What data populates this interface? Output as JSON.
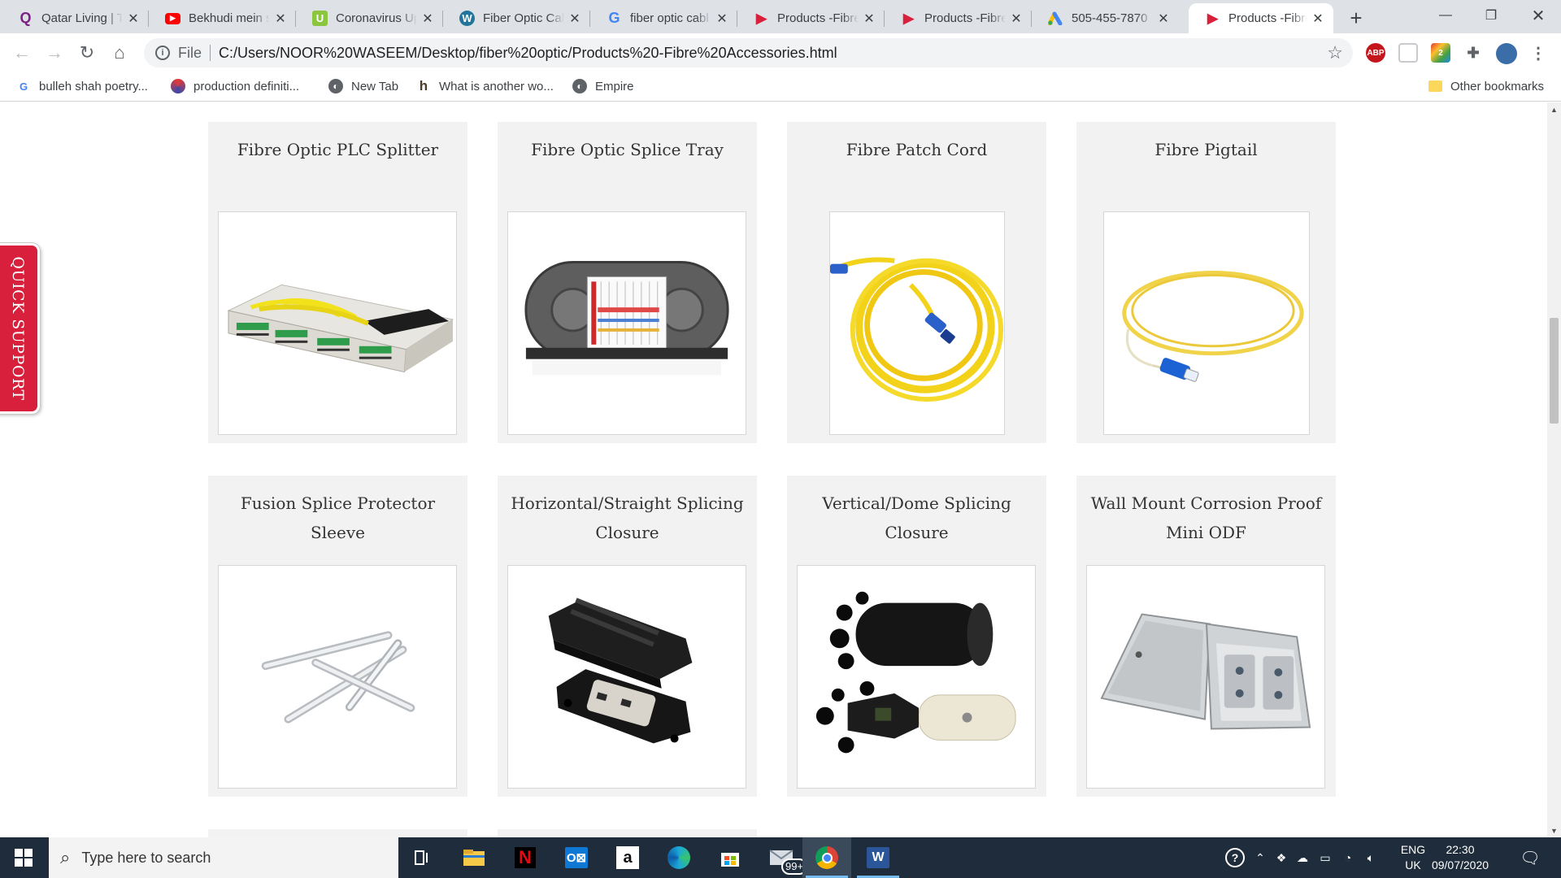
{
  "browser": {
    "tabs": [
      {
        "title": "Qatar Living | T",
        "icon": "qatar-living-icon",
        "color": "#7a2183"
      },
      {
        "title": "Bekhudi mein s",
        "icon": "youtube-icon",
        "color": "#ff0000"
      },
      {
        "title": "Coronavirus Up",
        "icon": "w-green-icon",
        "color": "#8cc63f"
      },
      {
        "title": "Fiber Optic Cab",
        "icon": "wordpress-icon",
        "color": "#21759b"
      },
      {
        "title": "fiber optic cabl",
        "icon": "google-icon",
        "color": "#4285f4"
      },
      {
        "title": "Products -Fibre",
        "icon": "red-arrow-icon",
        "color": "#d81f3b"
      },
      {
        "title": "Products -Fibre",
        "icon": "red-arrow-icon",
        "color": "#d81f3b"
      },
      {
        "title": "505-455-7870",
        "icon": "google-ads-icon",
        "color": "#fbbc04"
      },
      {
        "title": "Products -Fibre",
        "icon": "red-arrow-icon",
        "color": "#d81f3b"
      }
    ],
    "active_tab": 8,
    "address": {
      "scheme": "File",
      "url": "C:/Users/NOOR%20WASEEM/Desktop/fiber%20optic/Products%20-Fibre%20Accessories.html"
    },
    "extensions": [
      "abp-icon",
      "pocket-icon",
      "extension-2-icon",
      "puzzle-icon",
      "profile-avatar",
      "menu-dots-icon"
    ],
    "bookmarks": [
      {
        "label": "bulleh shah poetry...",
        "icon": "google-icon"
      },
      {
        "label": "production definiti...",
        "icon": "colorful-swirl-icon"
      },
      {
        "label": "New Tab",
        "icon": "globe-icon"
      },
      {
        "label": "What is another wo...",
        "icon": "h-letter-icon"
      },
      {
        "label": "Empire",
        "icon": "globe-icon"
      }
    ],
    "other_bookmarks": "Other bookmarks"
  },
  "page": {
    "quick_support": "QUICK SUPPORT",
    "products": [
      {
        "name": "Fibre Optic PLC Splitter",
        "image": "plc-splitter-image"
      },
      {
        "name": "Fibre Optic Splice Tray",
        "image": "splice-tray-image"
      },
      {
        "name": "Fibre Patch Cord",
        "image": "patch-cord-image"
      },
      {
        "name": "Fibre Pigtail",
        "image": "pigtail-image"
      },
      {
        "name": "Fusion Splice Protector Sleeve",
        "image": "splice-sleeve-image"
      },
      {
        "name": "Horizontal/Straight Splicing Closure",
        "image": "horizontal-closure-image"
      },
      {
        "name": "Vertical/Dome Splicing Closure",
        "image": "dome-closure-image"
      },
      {
        "name": "Wall Mount Corrosion Proof Mini ODF",
        "image": "mini-odf-image"
      }
    ]
  },
  "taskbar": {
    "search_placeholder": "Type here to search",
    "apps": [
      "task-view-icon",
      "file-explorer-icon",
      "netflix-icon",
      "outlook-icon",
      "amazon-icon",
      "edge-icon",
      "store-icon",
      "mail-icon",
      "chrome-icon",
      "word-icon"
    ],
    "mail_badge": "99+",
    "language": "ENG",
    "region": "UK",
    "time": "22:30",
    "date": "09/07/2020"
  }
}
